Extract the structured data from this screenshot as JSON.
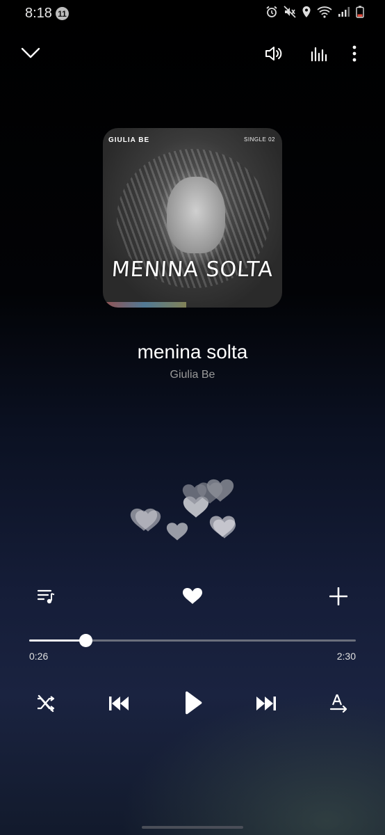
{
  "status_bar": {
    "time": "8:18",
    "notification_count": "11",
    "icons": [
      "alarm-icon",
      "mute-icon",
      "location-icon",
      "wifi-icon",
      "signal-icon",
      "battery-low-icon"
    ]
  },
  "top_bar": {
    "collapse_icon": "chevron-down-icon",
    "volume_icon": "volume-icon",
    "equalizer_icon": "equalizer-icon",
    "more_icon": "more-vertical-icon"
  },
  "album_art": {
    "brand_text": "GIULIA BE",
    "single_text": "SINGLE 02",
    "title_text": "MENINA SOLTA"
  },
  "track": {
    "title": "menina solta",
    "artist": "Giulia Be"
  },
  "actions": {
    "playlist_icon": "queue-music-icon",
    "favorite_icon": "heart-icon",
    "add_icon": "plus-icon"
  },
  "progress": {
    "elapsed": "0:26",
    "total": "2:30",
    "fraction": 0.173
  },
  "controls": {
    "shuffle_icon": "shuffle-off-icon",
    "previous_icon": "skip-previous-icon",
    "play_icon": "play-icon",
    "next_icon": "skip-next-icon",
    "repeat_icon": "repeat-a-icon"
  }
}
